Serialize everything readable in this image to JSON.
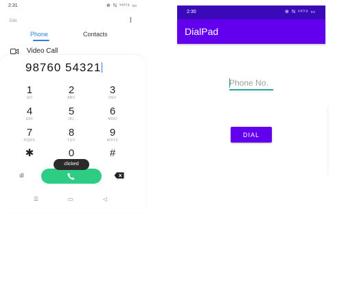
{
  "dialer": {
    "status_bar": {
      "time": "2:31",
      "icons": "⊕ ℕ ᵛᵒˡᵗᵉ ▭"
    },
    "edit_label": "Edit",
    "more_icon": "more-vert-icon",
    "tabs": [
      {
        "label": "Phone",
        "active": true
      },
      {
        "label": "Contacts",
        "active": false
      }
    ],
    "video_call_label": "Video Call",
    "number": "98760 54321",
    "keys": [
      {
        "digit": "1",
        "letters": "GD"
      },
      {
        "digit": "2",
        "letters": "ABC"
      },
      {
        "digit": "3",
        "letters": "DEF"
      },
      {
        "digit": "4",
        "letters": "GHI"
      },
      {
        "digit": "5",
        "letters": "JKL"
      },
      {
        "digit": "6",
        "letters": "MNO"
      },
      {
        "digit": "7",
        "letters": "PQRS"
      },
      {
        "digit": "8",
        "letters": "TUV"
      },
      {
        "digit": "9",
        "letters": "WXYZ"
      },
      {
        "digit": "✱",
        "letters": ""
      },
      {
        "digit": "0",
        "letters": ""
      },
      {
        "digit": "#",
        "letters": ""
      }
    ],
    "toast": "clicked",
    "accent_color": "#2a7fe0",
    "call_color": "#2dce84",
    "nav": {
      "menu": "☰",
      "home": "▭",
      "back": "◁"
    }
  },
  "app": {
    "status_bar": {
      "time": "2:30",
      "icons": "⊕ ℕ ᵛᵒˡᵗᵉ ▭"
    },
    "title": "DialPad",
    "phone_placeholder": "Phone No.",
    "dial_label": "DIAL",
    "primary_color": "#6200ee",
    "primary_dark_color": "#3a09b8",
    "accent_color": "#26a69a"
  }
}
